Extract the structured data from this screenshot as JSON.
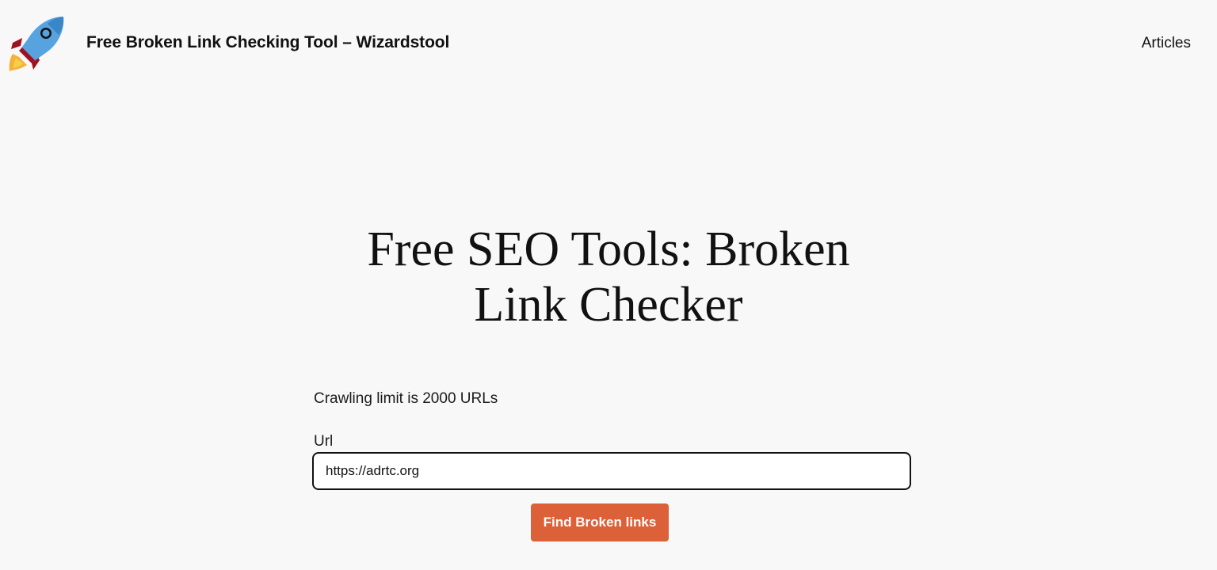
{
  "header": {
    "logo_icon": "rocket-icon",
    "site_title": "Free Broken Link Checking Tool – Wizardstool",
    "nav": {
      "articles_label": "Articles"
    }
  },
  "main": {
    "title_line1": "Free SEO Tools: Broken",
    "title_line2": "Link Checker",
    "limit_note": "Crawling limit is 2000 URLs",
    "url_label": "Url",
    "url_value": "https://adrtc.org",
    "submit_label": "Find Broken links"
  },
  "colors": {
    "background": "#f8f8f8",
    "accent_button": "#dc6138",
    "text": "#111111"
  }
}
